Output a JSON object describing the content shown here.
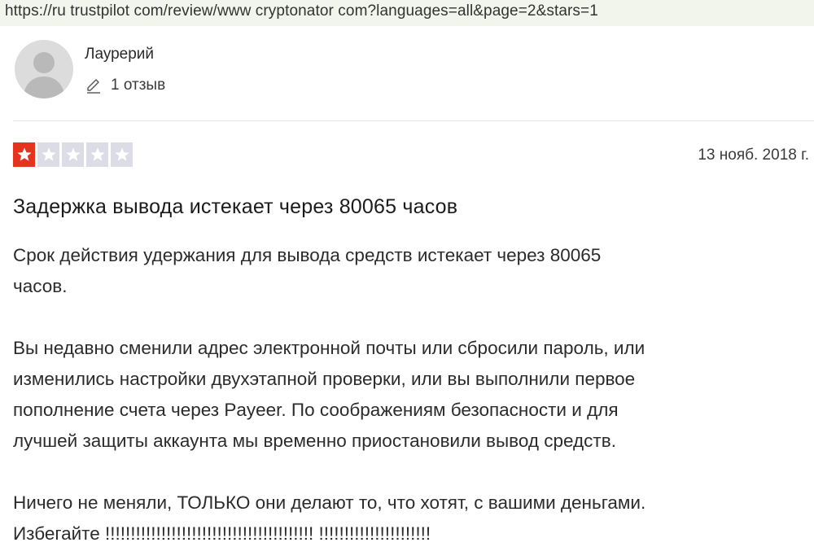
{
  "browser": {
    "url": "https://ru trustpilot com/review/www cryptonator com?languages=all&page=2&stars=1"
  },
  "review": {
    "author": {
      "name": "Лаурерий",
      "reviews_count": "1 отзыв",
      "avatar_icon": "person-silhouette-icon",
      "count_icon": "pencil-icon"
    },
    "rating": {
      "stars": 1,
      "max": 5,
      "active_color": "#e5341d",
      "inactive_color": "#dcdce6"
    },
    "date": "13 нояб. 2018 г.",
    "title": "Задержка вывода истекает через 80065 часов",
    "body": {
      "line1": "Срок действия удержания для вывода средств истекает через 80065",
      "line2": "часов.",
      "line3": "Вы недавно сменили адрес электронной почты или сбросили пароль, или",
      "line4": "изменились настройки двухэтапной проверки, или вы выполнили первое",
      "line5": "пополнение счета через Payeer. По соображениям безопасности и для",
      "line6": "лучшей защиты аккаунта мы временно приостановили вывод средств.",
      "line7": "Ничего не меняли, ТОЛЬКО они делают то, что хотят, с вашими деньгами.",
      "line8": "Избегайте !!!!!!!!!!!!!!!!!!!!!!!!!!!!!!!!!!!!!!!!! !!!!!!!!!!!!!!!!!!!!!!"
    }
  }
}
